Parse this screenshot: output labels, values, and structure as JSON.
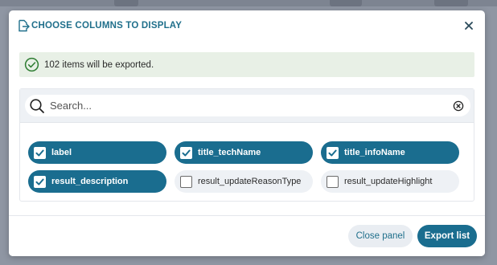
{
  "modal": {
    "title": "CHOOSE COLUMNS TO DISPLAY",
    "header_icon": "file-export-icon",
    "close_icon": "close-icon"
  },
  "alert": {
    "icon": "check-circle-icon",
    "message": "102 items will be exported."
  },
  "search": {
    "placeholder": "Search...",
    "value": "",
    "icon": "search-icon",
    "clear_icon": "clear-circle-icon"
  },
  "columns": [
    {
      "label": "label",
      "checked": true
    },
    {
      "label": "title_techName",
      "checked": true
    },
    {
      "label": "title_infoName",
      "checked": true
    },
    {
      "label": "result_description",
      "checked": true
    },
    {
      "label": "result_updateReasonType",
      "checked": false
    },
    {
      "label": "result_updateHighlight",
      "checked": false
    }
  ],
  "footer": {
    "close_label": "Close panel",
    "export_label": "Export list"
  },
  "colors": {
    "accent": "#1a6d8f",
    "title": "#1f6f8b",
    "success_bg": "#e8f0e6",
    "success_icon": "#2e7d32"
  }
}
